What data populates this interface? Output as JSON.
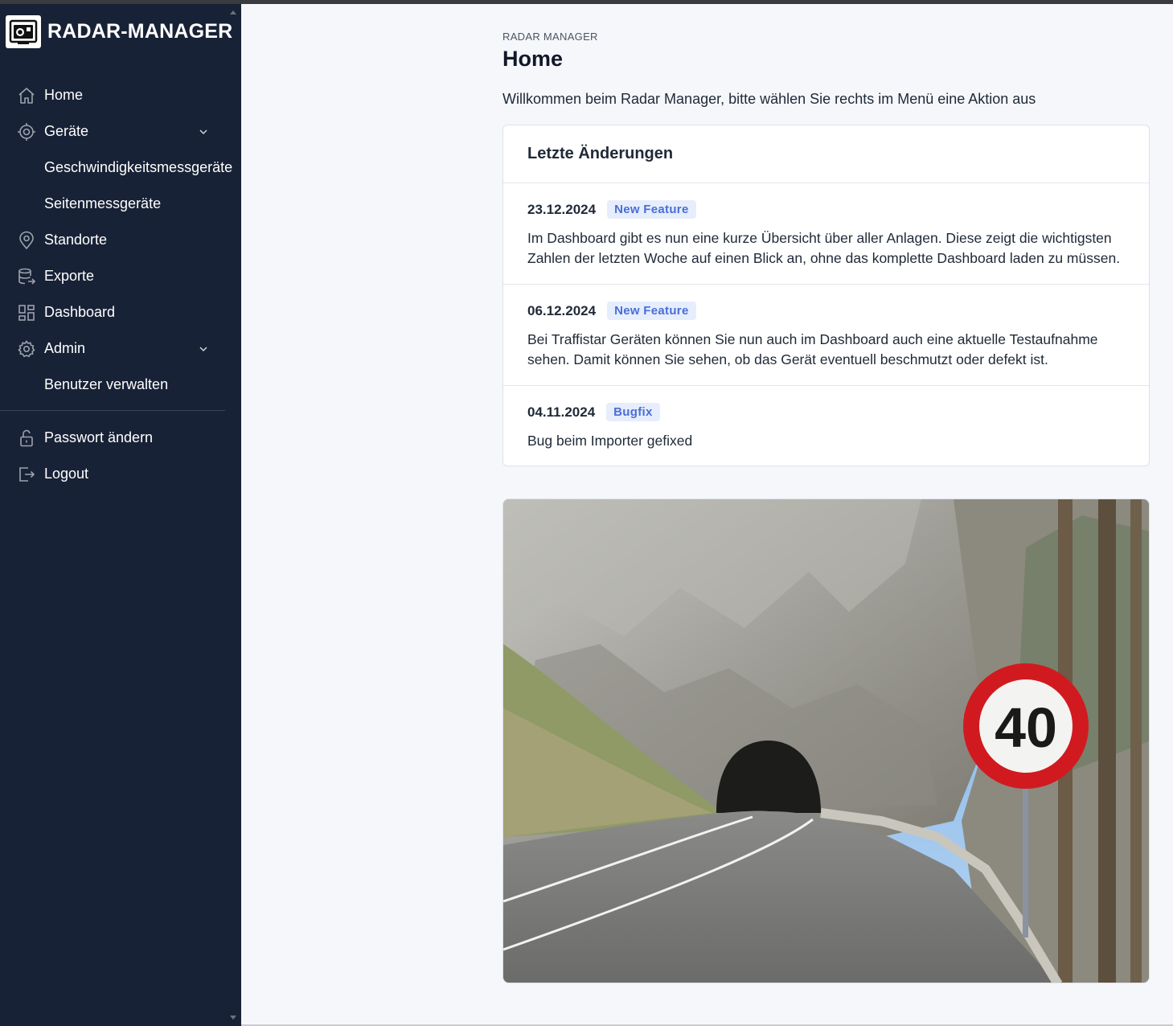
{
  "app": {
    "brand_name": "RADAR-MANAGER",
    "logo_icon": "speed-camera-icon"
  },
  "sidebar": {
    "items": [
      {
        "label": "Home",
        "icon": "home-icon"
      },
      {
        "label": "Geräte",
        "icon": "target-icon",
        "expandable": true
      },
      {
        "label": "Geschwindigkeitsmessgeräte",
        "sub": true
      },
      {
        "label": "Seitenmessgeräte",
        "sub": true
      },
      {
        "label": "Standorte",
        "icon": "map-pin-icon"
      },
      {
        "label": "Exporte",
        "icon": "database-export-icon"
      },
      {
        "label": "Dashboard",
        "icon": "dashboard-icon"
      },
      {
        "label": "Admin",
        "icon": "gear-icon",
        "expandable": true
      },
      {
        "label": "Benutzer verwalten",
        "sub": true
      },
      {
        "label": "Passwort ändern",
        "icon": "unlock-icon"
      },
      {
        "label": "Logout",
        "icon": "logout-icon"
      }
    ]
  },
  "main": {
    "breadcrumb": "RADAR MANAGER",
    "title": "Home",
    "welcome": "Willkommen beim Radar Manager, bitte wählen Sie rechts im Menü eine Aktion aus",
    "changes": {
      "title": "Letzte Änderungen",
      "entries": [
        {
          "date": "23.12.2024",
          "tag": "New Feature",
          "text": "Im Dashboard gibt es nun eine kurze Übersicht über aller Anlagen. Diese zeigt die wichtigsten Zahlen der letzten Woche auf einen Blick an, ohne das komplette Dashboard laden zu müssen."
        },
        {
          "date": "06.12.2024",
          "tag": "New Feature",
          "text": "Bei Traffistar Geräten können Sie nun auch im Dashboard auch eine aktuelle Testaufnahme sehen. Damit können Sie sehen, ob das Gerät eventuell beschmutzt oder defekt ist."
        },
        {
          "date": "04.11.2024",
          "tag": "Bugfix",
          "text": "Bug beim Importer gefixed"
        }
      ]
    },
    "photo": {
      "sign_text": "40"
    }
  },
  "colors": {
    "sidebar_bg": "#182236",
    "page_bg": "#f5f7fb",
    "badge_bg": "#e6edfc",
    "badge_text": "#4a6ed6"
  }
}
